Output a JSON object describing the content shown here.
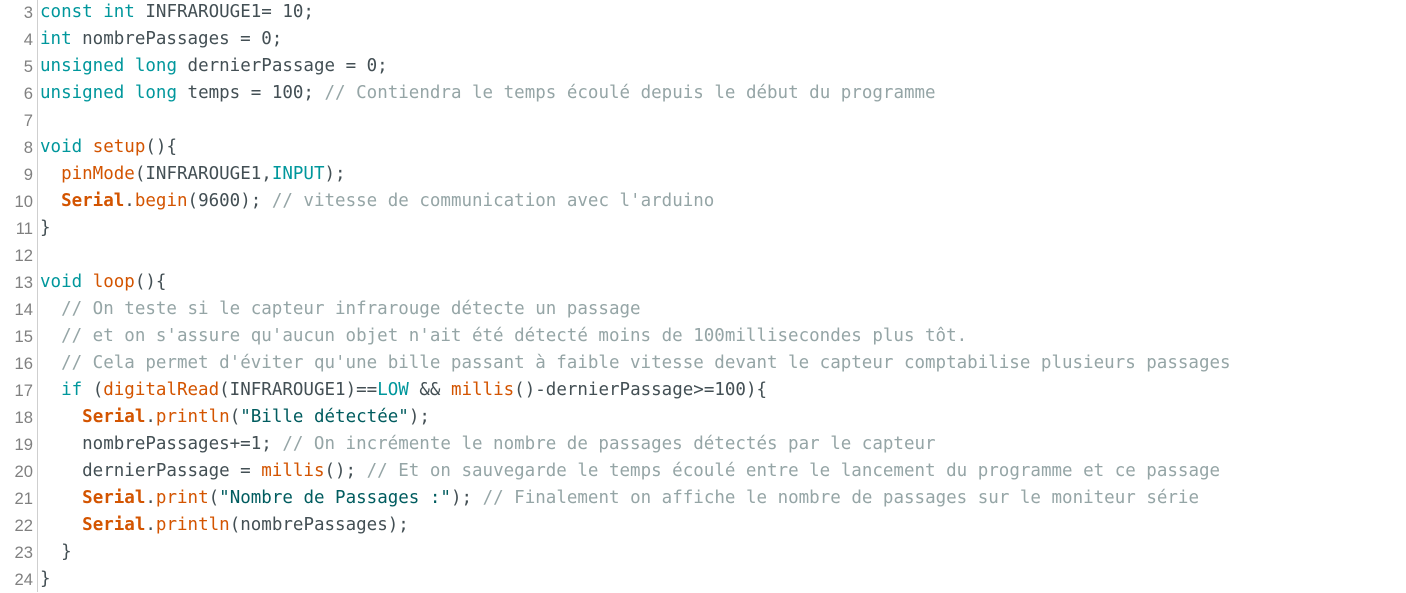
{
  "colors": {
    "keyword": "#00979c",
    "function": "#d35400",
    "class": "#d35400",
    "comment": "#95a5a6",
    "string": "#005c5f",
    "plain": "#434f54",
    "line_number": "#808080"
  },
  "editor": {
    "lines": [
      {
        "num": "3",
        "tokens": [
          {
            "t": "kw",
            "v": "const"
          },
          {
            "t": "pl",
            "v": " "
          },
          {
            "t": "kw",
            "v": "int"
          },
          {
            "t": "pl",
            "v": " INFRAROUGE1= 10;"
          }
        ]
      },
      {
        "num": "4",
        "tokens": [
          {
            "t": "kw",
            "v": "int"
          },
          {
            "t": "pl",
            "v": " nombrePassages = 0;"
          }
        ]
      },
      {
        "num": "5",
        "tokens": [
          {
            "t": "kw",
            "v": "unsigned"
          },
          {
            "t": "pl",
            "v": " "
          },
          {
            "t": "kw",
            "v": "long"
          },
          {
            "t": "pl",
            "v": " dernierPassage = 0;"
          }
        ]
      },
      {
        "num": "6",
        "tokens": [
          {
            "t": "kw",
            "v": "unsigned"
          },
          {
            "t": "pl",
            "v": " "
          },
          {
            "t": "kw",
            "v": "long"
          },
          {
            "t": "pl",
            "v": " temps = 100; "
          },
          {
            "t": "cm",
            "v": "// Contiendra le temps écoulé depuis le début du programme"
          }
        ]
      },
      {
        "num": "7",
        "tokens": []
      },
      {
        "num": "8",
        "tokens": [
          {
            "t": "kw",
            "v": "void"
          },
          {
            "t": "pl",
            "v": " "
          },
          {
            "t": "fn",
            "v": "setup"
          },
          {
            "t": "pl",
            "v": "(){"
          }
        ]
      },
      {
        "num": "9",
        "tokens": [
          {
            "t": "pl",
            "v": "  "
          },
          {
            "t": "fn",
            "v": "pinMode"
          },
          {
            "t": "pl",
            "v": "(INFRAROUGE1,"
          },
          {
            "t": "kw",
            "v": "INPUT"
          },
          {
            "t": "pl",
            "v": ");"
          }
        ]
      },
      {
        "num": "10",
        "tokens": [
          {
            "t": "pl",
            "v": "  "
          },
          {
            "t": "cls",
            "v": "Serial"
          },
          {
            "t": "pl",
            "v": "."
          },
          {
            "t": "fn",
            "v": "begin"
          },
          {
            "t": "pl",
            "v": "(9600); "
          },
          {
            "t": "cm",
            "v": "// vitesse de communication avec l'arduino"
          }
        ]
      },
      {
        "num": "11",
        "tokens": [
          {
            "t": "pl",
            "v": "}"
          }
        ]
      },
      {
        "num": "12",
        "tokens": []
      },
      {
        "num": "13",
        "tokens": [
          {
            "t": "kw",
            "v": "void"
          },
          {
            "t": "pl",
            "v": " "
          },
          {
            "t": "fn",
            "v": "loop"
          },
          {
            "t": "pl",
            "v": "(){"
          }
        ]
      },
      {
        "num": "14",
        "tokens": [
          {
            "t": "pl",
            "v": "  "
          },
          {
            "t": "cm",
            "v": "// On teste si le capteur infrarouge détecte un passage"
          }
        ]
      },
      {
        "num": "15",
        "tokens": [
          {
            "t": "pl",
            "v": "  "
          },
          {
            "t": "cm",
            "v": "// et on s'assure qu'aucun objet n'ait été détecté moins de 100millisecondes plus tôt."
          }
        ]
      },
      {
        "num": "16",
        "tokens": [
          {
            "t": "pl",
            "v": "  "
          },
          {
            "t": "cm",
            "v": "// Cela permet d'éviter qu'une bille passant à faible vitesse devant le capteur comptabilise plusieurs passages"
          }
        ]
      },
      {
        "num": "17",
        "tokens": [
          {
            "t": "pl",
            "v": "  "
          },
          {
            "t": "kw",
            "v": "if"
          },
          {
            "t": "pl",
            "v": " ("
          },
          {
            "t": "fn",
            "v": "digitalRead"
          },
          {
            "t": "pl",
            "v": "(INFRAROUGE1)=="
          },
          {
            "t": "kw",
            "v": "LOW"
          },
          {
            "t": "pl",
            "v": " && "
          },
          {
            "t": "fn",
            "v": "millis"
          },
          {
            "t": "pl",
            "v": "()-dernierPassage>=100){"
          }
        ]
      },
      {
        "num": "18",
        "tokens": [
          {
            "t": "pl",
            "v": "    "
          },
          {
            "t": "cls",
            "v": "Serial"
          },
          {
            "t": "pl",
            "v": "."
          },
          {
            "t": "fn",
            "v": "println"
          },
          {
            "t": "pl",
            "v": "("
          },
          {
            "t": "str",
            "v": "\"Bille détectée\""
          },
          {
            "t": "pl",
            "v": ");"
          }
        ]
      },
      {
        "num": "19",
        "tokens": [
          {
            "t": "pl",
            "v": "    nombrePassages+=1; "
          },
          {
            "t": "cm",
            "v": "// On incrémente le nombre de passages détectés par le capteur"
          }
        ]
      },
      {
        "num": "20",
        "tokens": [
          {
            "t": "pl",
            "v": "    dernierPassage = "
          },
          {
            "t": "fn",
            "v": "millis"
          },
          {
            "t": "pl",
            "v": "(); "
          },
          {
            "t": "cm",
            "v": "// Et on sauvegarde le temps écoulé entre le lancement du programme et ce passage"
          }
        ]
      },
      {
        "num": "21",
        "tokens": [
          {
            "t": "pl",
            "v": "    "
          },
          {
            "t": "cls",
            "v": "Serial"
          },
          {
            "t": "pl",
            "v": "."
          },
          {
            "t": "fn",
            "v": "print"
          },
          {
            "t": "pl",
            "v": "("
          },
          {
            "t": "str",
            "v": "\"Nombre de Passages :\""
          },
          {
            "t": "pl",
            "v": "); "
          },
          {
            "t": "cm",
            "v": "// Finalement on affiche le nombre de passages sur le moniteur série"
          }
        ]
      },
      {
        "num": "22",
        "tokens": [
          {
            "t": "pl",
            "v": "    "
          },
          {
            "t": "cls",
            "v": "Serial"
          },
          {
            "t": "pl",
            "v": "."
          },
          {
            "t": "fn",
            "v": "println"
          },
          {
            "t": "pl",
            "v": "(nombrePassages);"
          }
        ]
      },
      {
        "num": "23",
        "tokens": [
          {
            "t": "pl",
            "v": "  }"
          }
        ]
      },
      {
        "num": "24",
        "tokens": [
          {
            "t": "pl",
            "v": "}"
          }
        ]
      }
    ]
  }
}
